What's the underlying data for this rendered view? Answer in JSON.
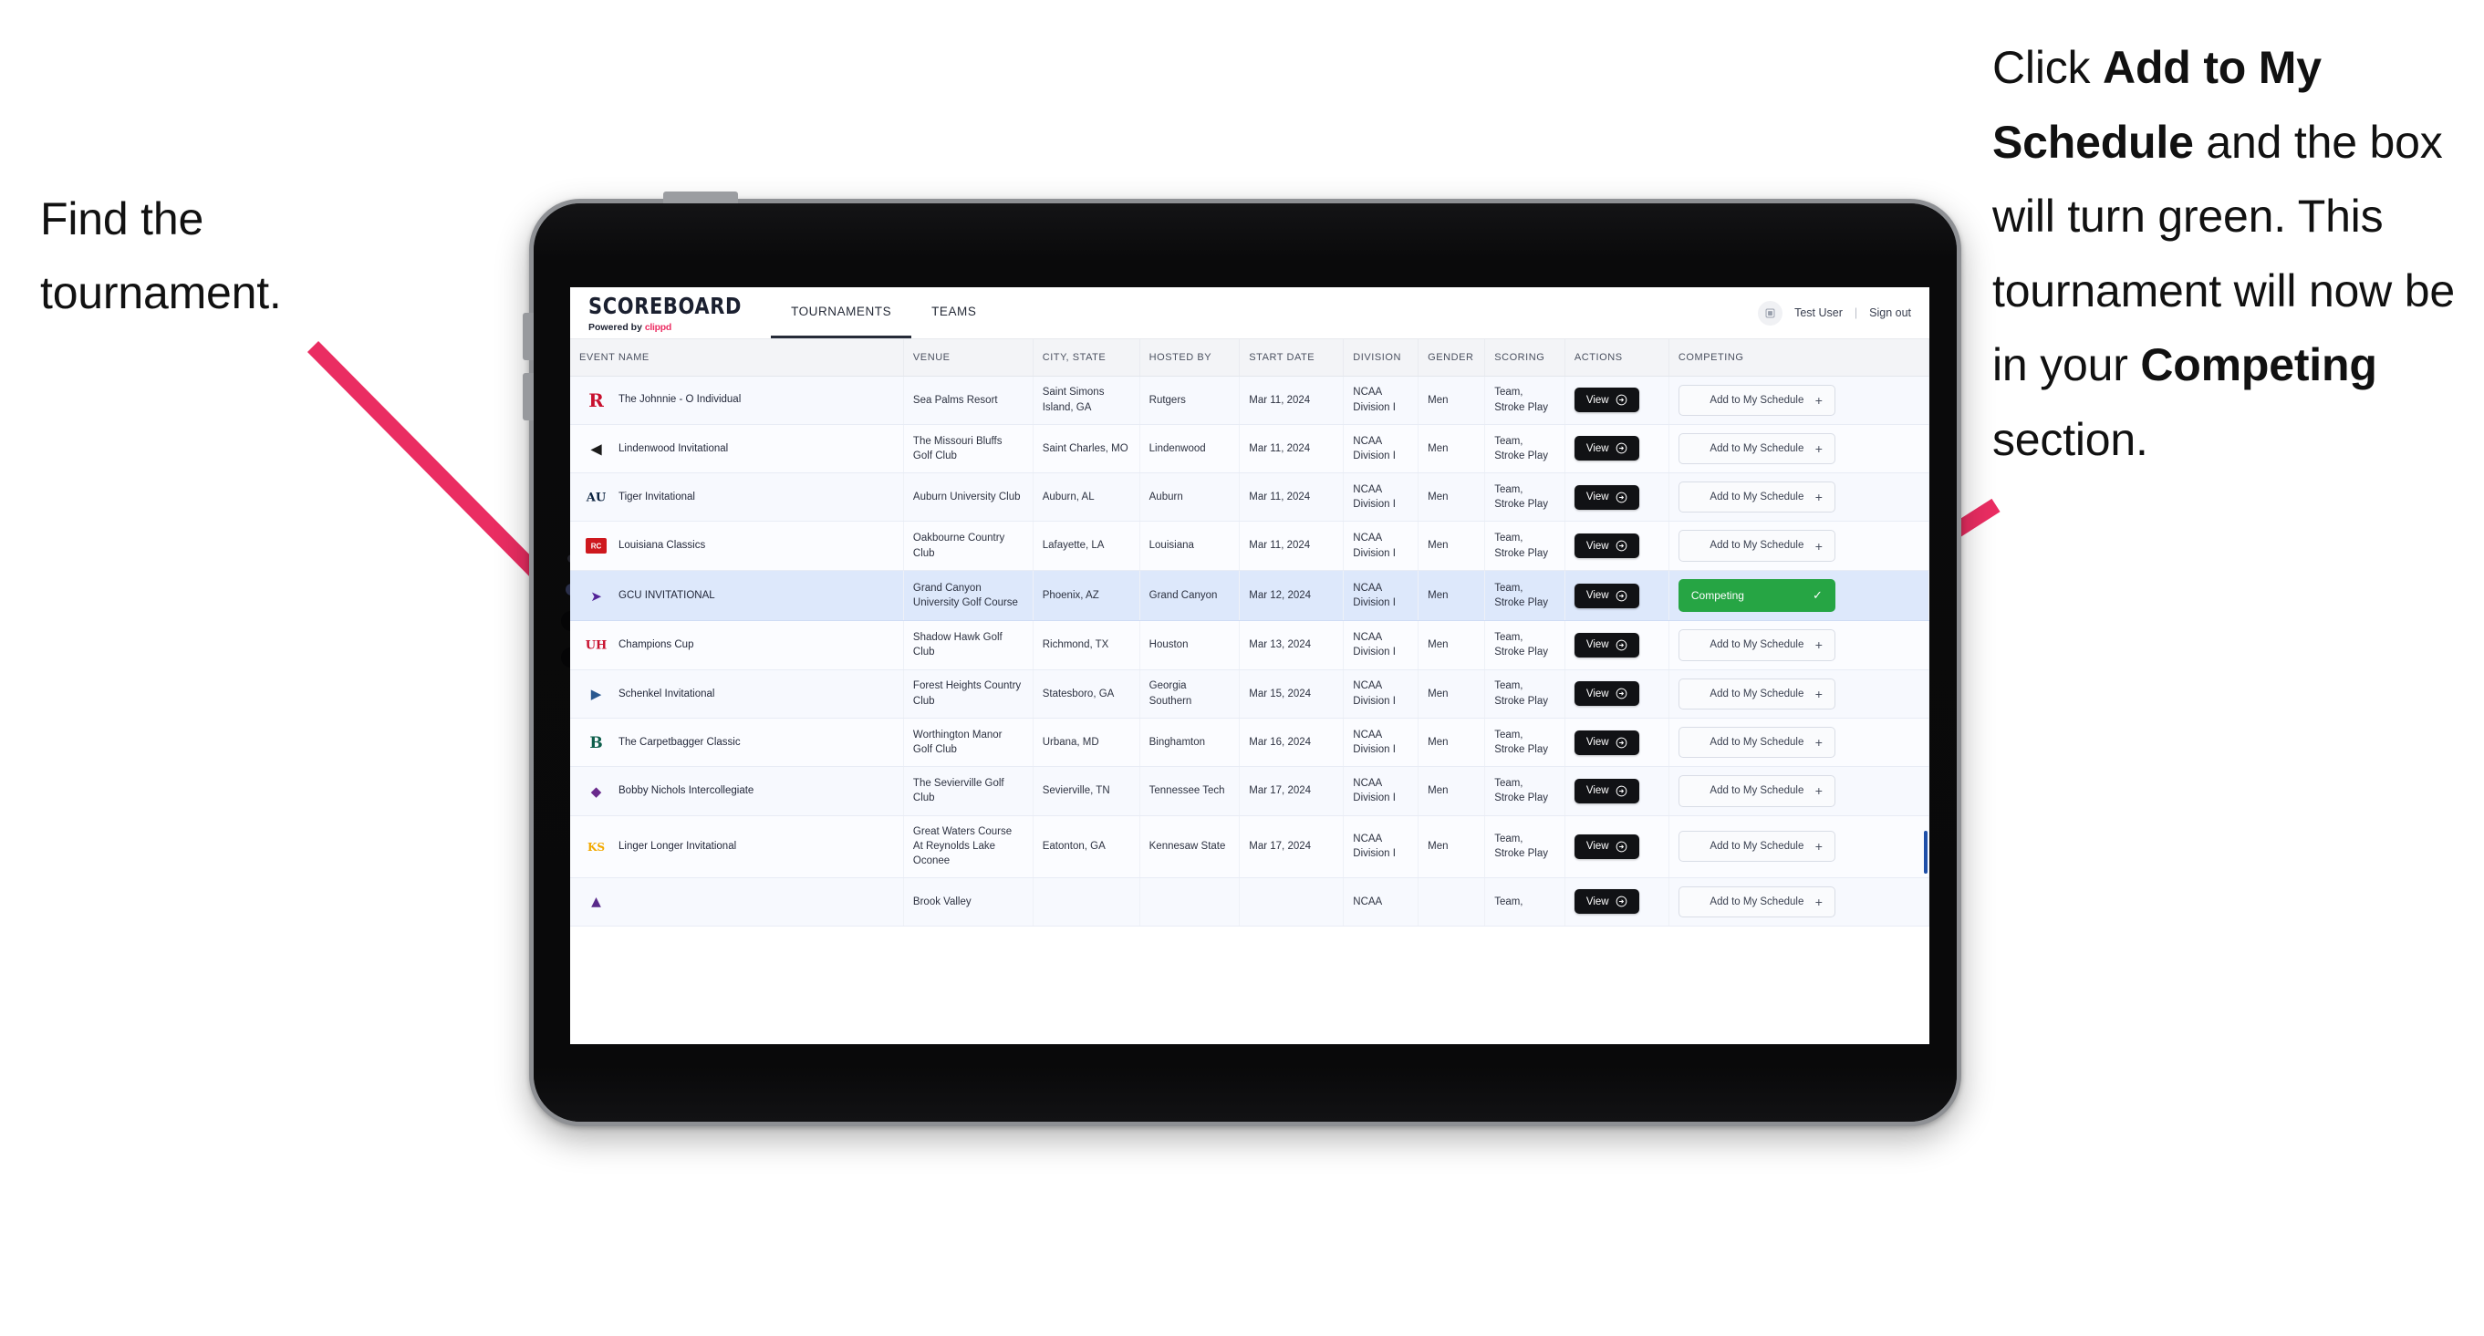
{
  "annotations": {
    "left": {
      "line1": "Find the",
      "line2": "tournament."
    },
    "right": {
      "p1_pre": "Click ",
      "p1_bold": "Add to My Schedule",
      "p1_post": " and the box will turn green. This tournament will now be in your ",
      "p2_bold": "Competing",
      "p2_post": " section."
    },
    "arrow_color": "#ea2d62"
  },
  "app": {
    "brand": {
      "title": "SCOREBOARD",
      "powered_prefix": "Powered by ",
      "powered_brand": "clippd"
    },
    "tabs": [
      {
        "label": "TOURNAMENTS",
        "active": true
      },
      {
        "label": "TEAMS",
        "active": false
      }
    ],
    "user": {
      "name": "Test User",
      "separator": "|",
      "signout": "Sign out"
    },
    "table": {
      "columns": [
        "EVENT NAME",
        "VENUE",
        "CITY, STATE",
        "HOSTED BY",
        "START DATE",
        "DIVISION",
        "GENDER",
        "SCORING",
        "ACTIONS",
        "COMPETING"
      ],
      "view_label": "View",
      "add_label": "Add to My Schedule",
      "add_icon": "+",
      "competing_label": "Competing",
      "competing_icon": "✓",
      "competing_color": "#26a544",
      "rows": [
        {
          "logo": "rutgers-r-logo",
          "event": "The Johnnie - O Individual",
          "venue": "Sea Palms Resort",
          "city": "Saint Simons Island, GA",
          "host": "Rutgers",
          "date": "Mar 11, 2024",
          "division": "NCAA Division I",
          "gender": "Men",
          "scoring": "Team, Stroke Play",
          "competing": false
        },
        {
          "logo": "lindenwood-lion-logo",
          "event": "Lindenwood Invitational",
          "venue": "The Missouri Bluffs Golf Club",
          "city": "Saint Charles, MO",
          "host": "Lindenwood",
          "date": "Mar 11, 2024",
          "division": "NCAA Division I",
          "gender": "Men",
          "scoring": "Team, Stroke Play",
          "competing": false
        },
        {
          "logo": "auburn-au-logo",
          "event": "Tiger Invitational",
          "venue": "Auburn University Club",
          "city": "Auburn, AL",
          "host": "Auburn",
          "date": "Mar 11, 2024",
          "division": "NCAA Division I",
          "gender": "Men",
          "scoring": "Team, Stroke Play",
          "competing": false
        },
        {
          "logo": "louisiana-ragin-cajuns-logo",
          "event": "Louisiana Classics",
          "venue": "Oakbourne Country Club",
          "city": "Lafayette, LA",
          "host": "Louisiana",
          "date": "Mar 11, 2024",
          "division": "NCAA Division I",
          "gender": "Men",
          "scoring": "Team, Stroke Play",
          "competing": false
        },
        {
          "logo": "grand-canyon-lopes-logo",
          "event": "GCU INVITATIONAL",
          "venue": "Grand Canyon University Golf Course",
          "city": "Phoenix, AZ",
          "host": "Grand Canyon",
          "date": "Mar 12, 2024",
          "division": "NCAA Division I",
          "gender": "Men",
          "scoring": "Team, Stroke Play",
          "competing": true
        },
        {
          "logo": "houston-uh-logo",
          "event": "Champions Cup",
          "venue": "Shadow Hawk Golf Club",
          "city": "Richmond, TX",
          "host": "Houston",
          "date": "Mar 13, 2024",
          "division": "NCAA Division I",
          "gender": "Men",
          "scoring": "Team, Stroke Play",
          "competing": false
        },
        {
          "logo": "georgia-southern-eagles-logo",
          "event": "Schenkel Invitational",
          "venue": "Forest Heights Country Club",
          "city": "Statesboro, GA",
          "host": "Georgia Southern",
          "date": "Mar 15, 2024",
          "division": "NCAA Division I",
          "gender": "Men",
          "scoring": "Team, Stroke Play",
          "competing": false
        },
        {
          "logo": "binghamton-b-logo",
          "event": "The Carpetbagger Classic",
          "venue": "Worthington Manor Golf Club",
          "city": "Urbana, MD",
          "host": "Binghamton",
          "date": "Mar 16, 2024",
          "division": "NCAA Division I",
          "gender": "Men",
          "scoring": "Team, Stroke Play",
          "competing": false
        },
        {
          "logo": "tennessee-tech-eagle-logo",
          "event": "Bobby Nichols Intercollegiate",
          "venue": "The Sevierville Golf Club",
          "city": "Sevierville, TN",
          "host": "Tennessee Tech",
          "date": "Mar 17, 2024",
          "division": "NCAA Division I",
          "gender": "Men",
          "scoring": "Team, Stroke Play",
          "competing": false
        },
        {
          "logo": "kennesaw-state-ks-logo",
          "event": "Linger Longer Invitational",
          "venue": "Great Waters Course At Reynolds Lake Oconee",
          "city": "Eatonton, GA",
          "host": "Kennesaw State",
          "date": "Mar 17, 2024",
          "division": "NCAA Division I",
          "gender": "Men",
          "scoring": "Team, Stroke Play",
          "competing": false
        },
        {
          "logo": "east-carolina-logo",
          "event": "",
          "venue": "Brook Valley",
          "city": "",
          "host": "",
          "date": "",
          "division": "NCAA",
          "gender": "",
          "scoring": "Team,",
          "competing": false
        }
      ]
    }
  }
}
